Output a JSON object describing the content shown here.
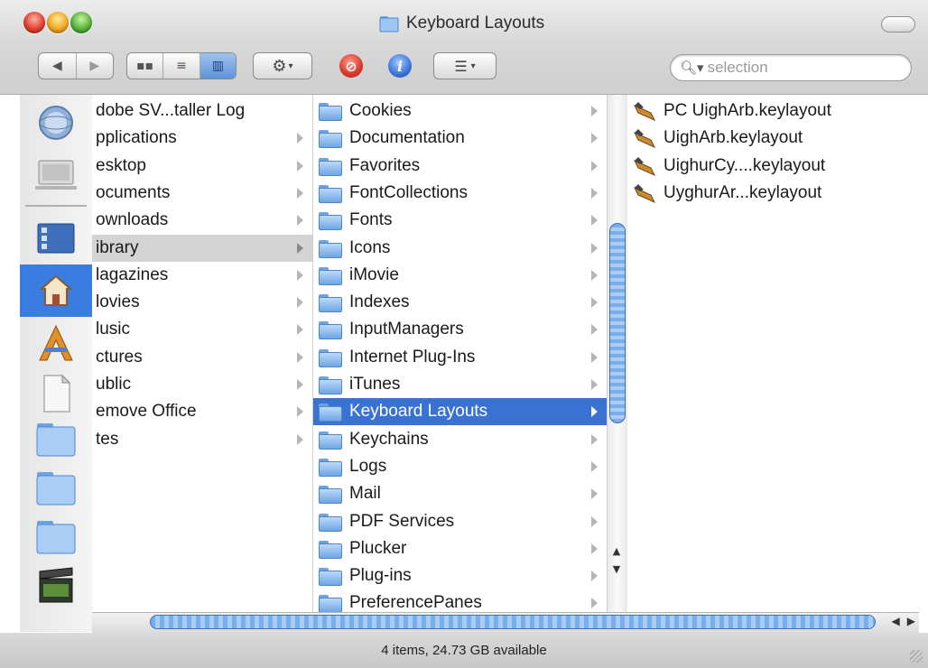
{
  "window": {
    "title": "Keyboard Layouts",
    "search_placeholder": "selection",
    "status": "4 items, 24.73 GB available"
  },
  "toolbar": {
    "back_icon": "back-arrow-icon",
    "forward_icon": "forward-arrow-icon",
    "view_modes": [
      "icon-view",
      "list-view",
      "column-view"
    ],
    "active_view": "column-view",
    "action_icon": "gear-icon",
    "burn_icon": "burn-icon",
    "info_icon": "info-icon",
    "arrange_icon": "arrange-icon"
  },
  "sidebar": {
    "items": [
      "network-icon",
      "computer-icon",
      "desktop-icon",
      "home-icon",
      "applications-icon",
      "documents-icon",
      "folder-icon",
      "folder-icon",
      "folder-icon",
      "movie-icon"
    ],
    "selected": "home-icon"
  },
  "columns": {
    "col1": [
      {
        "label": "dobe SV...taller Log",
        "arrow": false
      },
      {
        "label": "pplications",
        "arrow": true
      },
      {
        "label": "esktop",
        "arrow": true
      },
      {
        "label": "ocuments",
        "arrow": true
      },
      {
        "label": "ownloads",
        "arrow": true
      },
      {
        "label": "ibrary",
        "arrow": true,
        "selected": true
      },
      {
        "label": "lagazines",
        "arrow": true
      },
      {
        "label": "lovies",
        "arrow": true
      },
      {
        "label": "lusic",
        "arrow": true
      },
      {
        "label": "ctures",
        "arrow": true
      },
      {
        "label": "ublic",
        "arrow": true
      },
      {
        "label": "emove Office",
        "arrow": true
      },
      {
        "label": "tes",
        "arrow": true
      }
    ],
    "col2": [
      {
        "label": "Cookies"
      },
      {
        "label": "Documentation"
      },
      {
        "label": "Favorites"
      },
      {
        "label": "FontCollections"
      },
      {
        "label": "Fonts"
      },
      {
        "label": "Icons"
      },
      {
        "label": "iMovie"
      },
      {
        "label": "Indexes"
      },
      {
        "label": "InputManagers"
      },
      {
        "label": "Internet Plug-Ins"
      },
      {
        "label": "iTunes"
      },
      {
        "label": "Keyboard Layouts",
        "selected": true
      },
      {
        "label": "Keychains"
      },
      {
        "label": "Logs"
      },
      {
        "label": "Mail"
      },
      {
        "label": "PDF Services"
      },
      {
        "label": "Plucker"
      },
      {
        "label": "Plug-ins"
      },
      {
        "label": "PreferencePanes"
      }
    ],
    "col3": [
      {
        "label": "PC UighArb.keylayout"
      },
      {
        "label": "UighArb.keylayout"
      },
      {
        "label": "UighurCy....keylayout"
      },
      {
        "label": "UyghurAr...keylayout"
      }
    ]
  }
}
